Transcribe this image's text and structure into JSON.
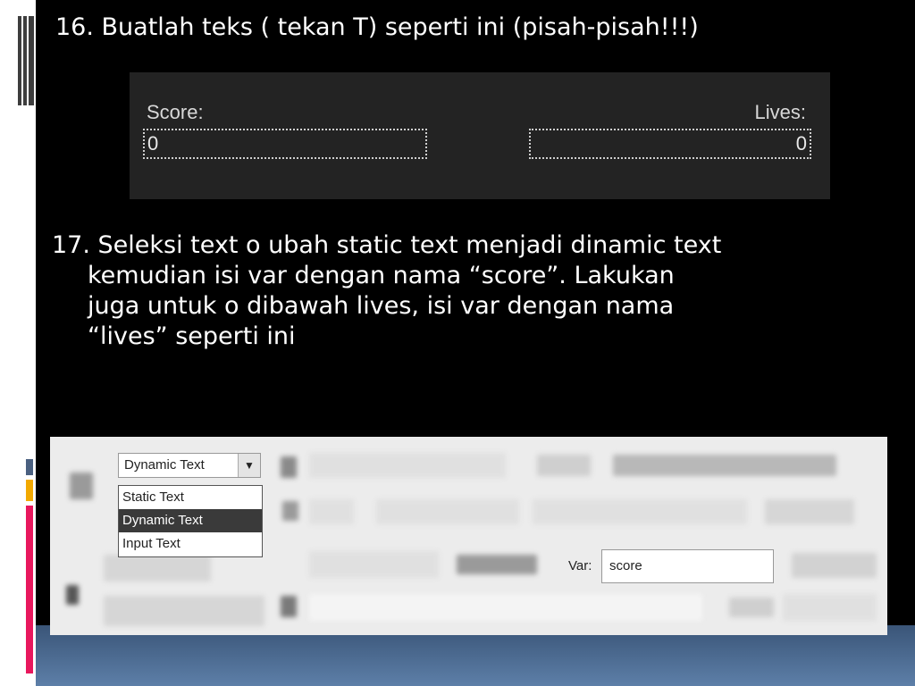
{
  "heading16": "16. Buatlah teks ( tekan T) seperti ini (pisah-pisah!!!)",
  "heading17_line1": "17. Seleksi text o ubah static text menjadi dinamic text",
  "heading17_line2": "kemudian isi var dengan nama “score”. Lakukan",
  "heading17_line3": "juga untuk o dibawah lives, isi var dengan nama",
  "heading17_line4": "“lives” seperti ini",
  "score_panel": {
    "score_label": "Score:",
    "score_value": "0",
    "lives_label": "Lives:",
    "lives_value": "0"
  },
  "properties": {
    "text_type_selected": "Dynamic Text",
    "text_type_options": [
      "Static Text",
      "Dynamic Text",
      "Input Text"
    ],
    "var_label": "Var:",
    "var_value": "score"
  },
  "colors": {
    "background": "#000000",
    "sidebar": "#ffffff",
    "accent_pink": "#e8175d",
    "accent_orange": "#f2a900",
    "accent_slate": "#4a6080"
  }
}
